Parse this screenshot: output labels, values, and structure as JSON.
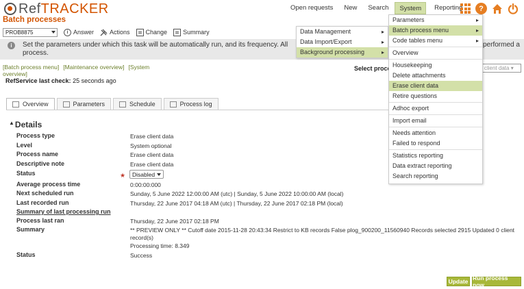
{
  "app": {
    "logo_ref": "Ref",
    "logo_tracker": "TRACKER",
    "page_title": "Batch processes"
  },
  "nav": [
    "Open requests",
    "New",
    "Search",
    "System",
    "Reporting"
  ],
  "top_icons": [
    "apps-grid-icon",
    "help-icon",
    "home-icon",
    "power-icon"
  ],
  "toolbar": {
    "record_select": "PROB8875",
    "answer": "Answer",
    "actions": "Actions",
    "change": "Change",
    "summary": "Summary"
  },
  "banner": {
    "text1": "Set the parameters under which this task will be automatically run, and its frequency. All",
    "text2": "process.",
    "text_right": "performed a"
  },
  "links": {
    "batch": "[Batch process menu]",
    "maint": "[Maintenance overview]",
    "system": "[System",
    "system2": "overview]"
  },
  "select_process": {
    "label": "Select proce",
    "value": "client data"
  },
  "last_check": {
    "label": "RefService last check:",
    "value": "25 seconds ago"
  },
  "tabs": [
    "Overview",
    "Parameters",
    "Schedule",
    "Process log"
  ],
  "details": {
    "title": "Details",
    "process_type_label": "Process type",
    "process_type": "Erase client data",
    "level_label": "Level",
    "level": "System optional",
    "process_name_label": "Process name",
    "process_name": "Erase client data",
    "note_label": "Descriptive note",
    "note": "Erase client data",
    "status_label": "Status",
    "status": "Disabled",
    "avg_label": "Average process time",
    "avg": "0:00:00:000",
    "next_label": "Next scheduled run",
    "next": "Sunday, 5 June 2022 12:00:00 AM (utc) | Sunday, 5 June 2022 10:00:00 AM (local)",
    "last_label": "Last recorded run",
    "last": "Thursday, 22 June 2017 04:18 AM (utc) | Thursday, 22 June 2017 02:18 PM (local)",
    "summary_heading": "Summary of last processing run",
    "proc_last_label": "Process last ran",
    "proc_last": "Thursday, 22 June 2017 02:18 PM",
    "summary_label": "Summary",
    "summary1": "** PREVIEW ONLY ** Cutoff date 2015-11-28 20:43:34 Restrict to KB records False plog_900200_11560940 Records selected 2915 Updated 0 client",
    "summary2": "record(s)",
    "summary3": "Processing time: 8.349",
    "status2_label": "Status",
    "status2": "Success"
  },
  "buttons": {
    "update": "Update",
    "run_now": "Run process now"
  },
  "system_menu": [
    "Data Management",
    "Data Import/Export",
    "Background processing"
  ],
  "submenu": {
    "group1": [
      "Parameters",
      "Batch process menu",
      "Code tables menu"
    ],
    "group2": [
      "Overview"
    ],
    "group3": [
      "Housekeeping",
      "Delete attachments",
      "Erase client data",
      "Retire questions"
    ],
    "group4": [
      "Adhoc export"
    ],
    "group5": [
      "Import email"
    ],
    "group6": [
      "Needs attention",
      "Failed to respond"
    ],
    "group7": [
      "Statistics reporting",
      "Data extract reporting",
      "Search reporting"
    ]
  },
  "colors": {
    "brand": "#d35400",
    "highlight": "#d3e0a8",
    "button": "#a8b83a"
  }
}
